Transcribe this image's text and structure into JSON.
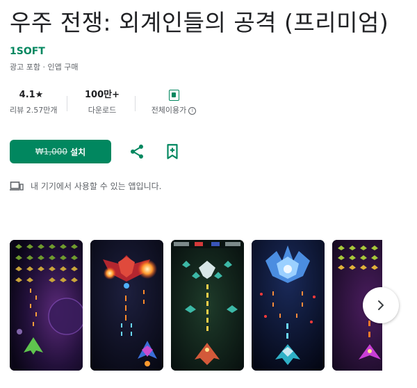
{
  "app": {
    "title": "우주 전쟁: 외계인들의 공격 (프리미엄)",
    "developer": "1SOFT",
    "meta": "광고 포함 · 인앱 구매"
  },
  "stats": [
    {
      "value": "4.1★",
      "label": "리뷰 2.57만개"
    },
    {
      "value": "100만+",
      "label": "다운로드"
    },
    {
      "value": "",
      "label": "전체이용가"
    }
  ],
  "actions": {
    "old_price": "₩1,000",
    "install_label": "설치"
  },
  "device_note": "내 기기에서 사용할 수 있는 앱입니다.",
  "icons": {
    "share": "share-icon",
    "wishlist": "bookmark-add-icon",
    "device": "devices-icon",
    "next": "chevron-right-icon",
    "rating": "content-rating-icon",
    "info": "info-icon"
  },
  "colors": {
    "accent": "#01875f",
    "text": "#202124",
    "secondary": "#5f6368"
  },
  "screenshots": {
    "count": 5
  }
}
